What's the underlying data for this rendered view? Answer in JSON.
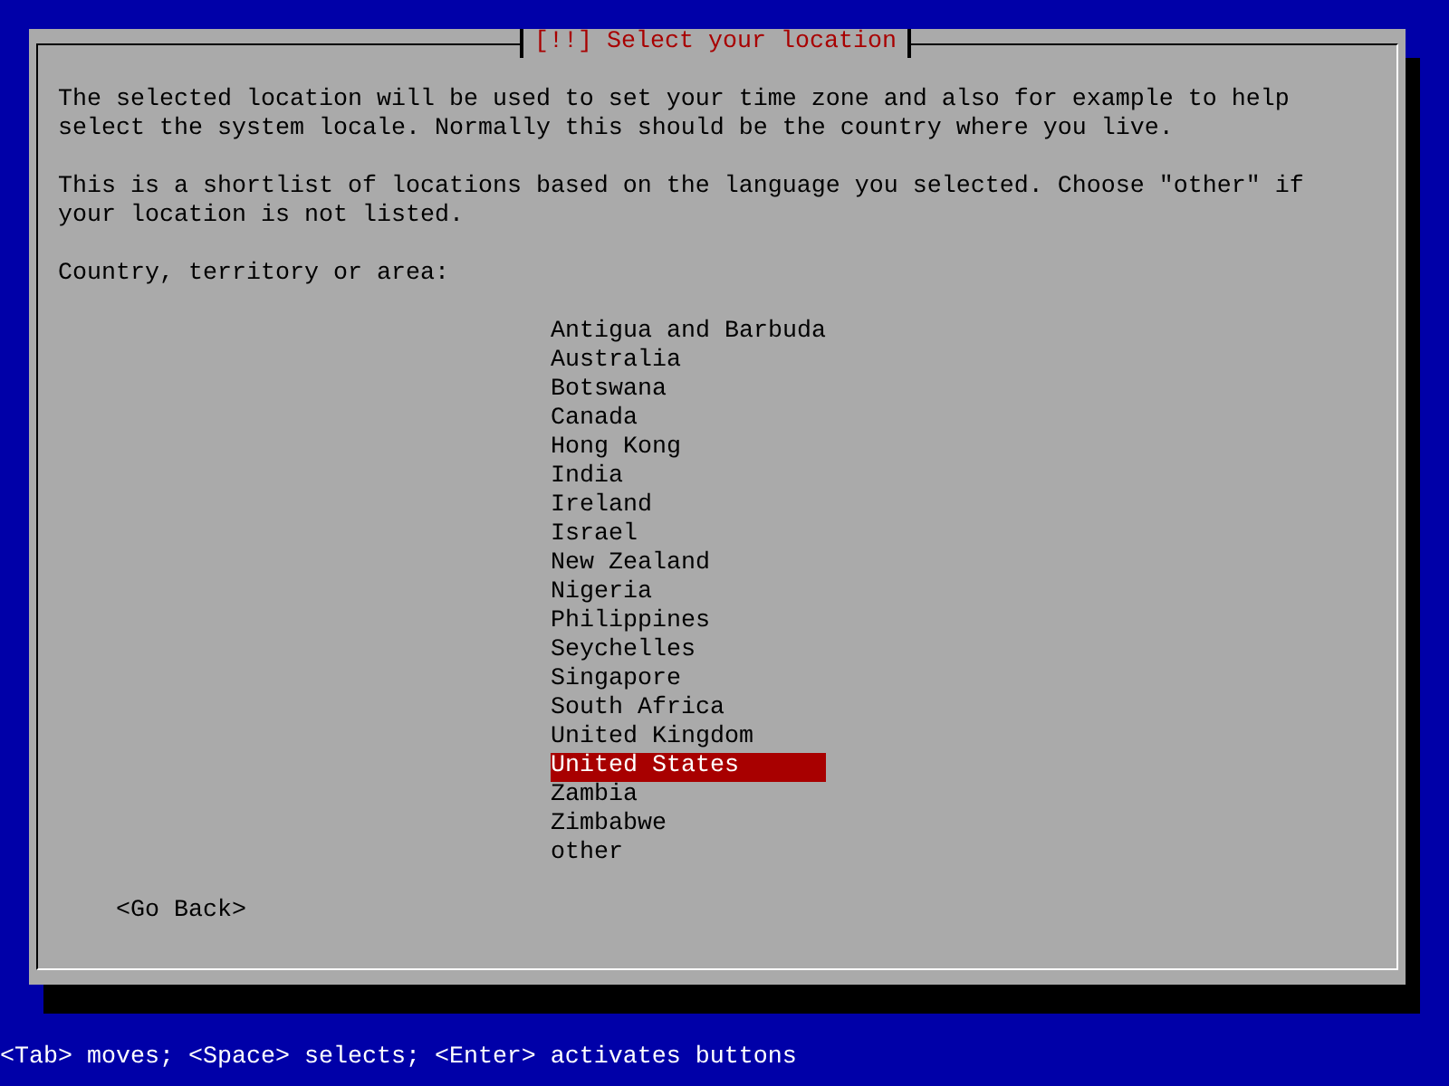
{
  "dialog": {
    "title": "[!!] Select your location",
    "paragraphs": [
      "The selected location will be used to set your time zone and also for example to help\nselect the system locale. Normally this should be the country where you live.",
      "This is a shortlist of locations based on the language you selected. Choose \"other\" if\nyour location is not listed."
    ],
    "list_label": "Country, territory or area:",
    "items": [
      {
        "label": "Antigua and Barbuda",
        "selected": false
      },
      {
        "label": "Australia",
        "selected": false
      },
      {
        "label": "Botswana",
        "selected": false
      },
      {
        "label": "Canada",
        "selected": false
      },
      {
        "label": "Hong Kong",
        "selected": false
      },
      {
        "label": "India",
        "selected": false
      },
      {
        "label": "Ireland",
        "selected": false
      },
      {
        "label": "Israel",
        "selected": false
      },
      {
        "label": "New Zealand",
        "selected": false
      },
      {
        "label": "Nigeria",
        "selected": false
      },
      {
        "label": "Philippines",
        "selected": false
      },
      {
        "label": "Seychelles",
        "selected": false
      },
      {
        "label": "Singapore",
        "selected": false
      },
      {
        "label": "South Africa",
        "selected": false
      },
      {
        "label": "United Kingdom",
        "selected": false
      },
      {
        "label": "United States",
        "selected": true
      },
      {
        "label": "Zambia",
        "selected": false
      },
      {
        "label": "Zimbabwe",
        "selected": false
      },
      {
        "label": "other",
        "selected": false
      }
    ],
    "buttons": [
      "<Go Back>"
    ]
  },
  "status_bar": "<Tab> moves; <Space> selects; <Enter> activates buttons"
}
